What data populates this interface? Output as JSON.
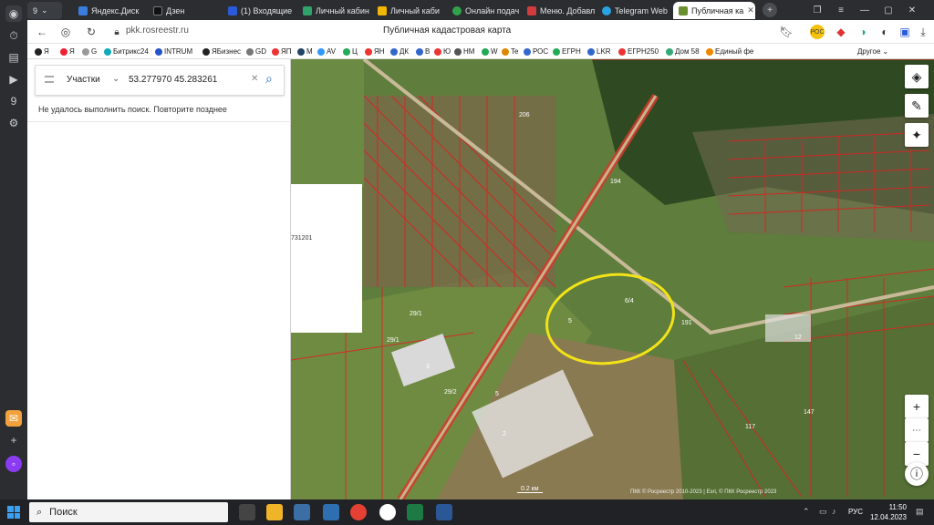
{
  "browser": {
    "tabs": [
      {
        "label": "Яндекс.Диск",
        "color": "#3b7ddd"
      },
      {
        "label": "Дзен",
        "color": "#111111"
      },
      {
        "label": "(1) Входящие",
        "color": "#2a5ad7"
      },
      {
        "label": "Личный кабин",
        "color": "#2fa36b"
      },
      {
        "label": "Личный каби",
        "color": "#f2b705"
      },
      {
        "label": "Онлайн подач",
        "color": "#31a24c"
      },
      {
        "label": "Меню. Добавл",
        "color": "#d23c3c"
      },
      {
        "label": "Telegram Web",
        "color": "#2aa3e2"
      },
      {
        "label": "Публичная ка",
        "color": "#6a8f2e"
      }
    ],
    "tab_counter": "9",
    "url": "pkk.rosreestr.ru",
    "page_title": "Публичная кадастровая карта",
    "bookmarks": [
      "Я",
      "Я",
      "G",
      "Битрикс24",
      "INTRUM",
      "ЯБизнес",
      "GD",
      "ЯП",
      "M",
      "AV",
      "Ц",
      "ЯН",
      "ДК",
      "В",
      "Ю",
      "НМ",
      "W",
      "Te",
      "РОС",
      "ЕГРН",
      "LKR",
      "ЕГРН250",
      "Дом 58",
      "Единый фе"
    ],
    "bookmarks_more": "Другое"
  },
  "search": {
    "type_label": "Участки",
    "query": "53.277970 45.283261",
    "error": "Не удалось выполнить поиск. Повторите позднее"
  },
  "map": {
    "labels": [
      "731201",
      "206",
      "194",
      "29/1",
      "29/1",
      "3",
      "29/2",
      "5",
      "5",
      "6/4",
      "191",
      "2",
      "12",
      "147",
      "117"
    ],
    "scale": "0.2 км",
    "copyright": "ПКК © Росреестр 2010-2023 | Esri, © ПКК Росреестр 2023"
  },
  "taskbar": {
    "search_label": "Поиск",
    "lang": "РУС",
    "time": "11:50",
    "date": "12.04.2023"
  }
}
